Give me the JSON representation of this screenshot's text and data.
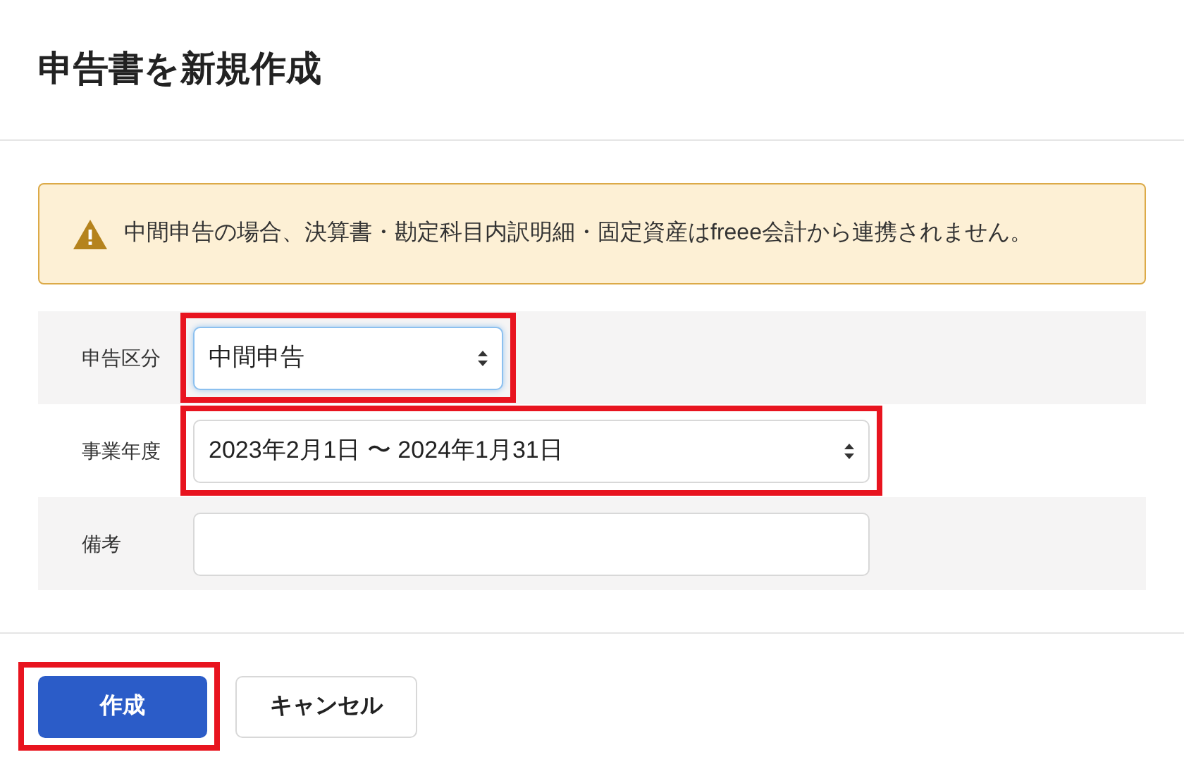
{
  "title": "申告書を新規作成",
  "alert": {
    "text": "中間申告の場合、決算書・勘定科目内訳明細・固定資産はfreee会計から連携されません。"
  },
  "fields": [
    {
      "label": "申告区分",
      "kind": "select",
      "value": "中間申告",
      "focused": true,
      "highlighted": true
    },
    {
      "label": "事業年度",
      "kind": "select",
      "value": "2023年2月1日 〜 2024年1月31日",
      "focused": false,
      "highlighted": true
    },
    {
      "label": "備考",
      "kind": "text",
      "focused": false,
      "highlighted": false
    }
  ],
  "buttons": [
    {
      "label": "作成",
      "kind": "primary",
      "highlighted": true
    },
    {
      "label": "キャンセル",
      "kind": "secondary",
      "highlighted": false
    }
  ]
}
